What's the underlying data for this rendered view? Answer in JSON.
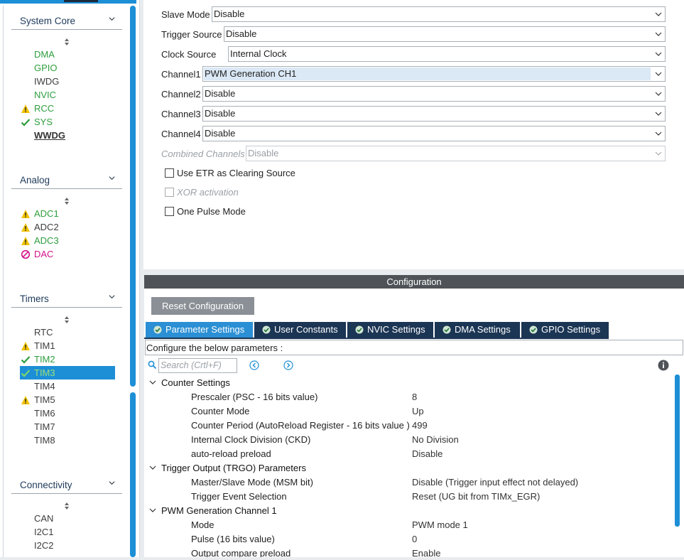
{
  "sidebar": {
    "categories": [
      {
        "label": "System Core",
        "items": [
          {
            "label": "DMA",
            "status": "ok",
            "color": "green"
          },
          {
            "label": "GPIO",
            "status": "ok",
            "color": "green"
          },
          {
            "label": "IWDG",
            "status": "none",
            "color": "gray"
          },
          {
            "label": "NVIC",
            "status": "ok",
            "color": "green"
          },
          {
            "label": "RCC",
            "status": "warning",
            "color": "green"
          },
          {
            "label": "SYS",
            "status": "checked",
            "color": "green"
          },
          {
            "label": "WWDG",
            "status": "none",
            "color": "gray"
          }
        ]
      },
      {
        "label": "Analog",
        "items": [
          {
            "label": "ADC1",
            "status": "warning",
            "color": "green"
          },
          {
            "label": "ADC2",
            "status": "warning",
            "color": "gray"
          },
          {
            "label": "ADC3",
            "status": "warning",
            "color": "green"
          },
          {
            "label": "DAC",
            "status": "disabled",
            "color": "pink"
          }
        ]
      },
      {
        "label": "Timers",
        "items": [
          {
            "label": "RTC",
            "status": "none",
            "color": "gray"
          },
          {
            "label": "TIM1",
            "status": "warning",
            "color": "gray"
          },
          {
            "label": "TIM2",
            "status": "checked",
            "color": "green"
          },
          {
            "label": "TIM3",
            "status": "checked",
            "color": "green",
            "selected": true
          },
          {
            "label": "TIM4",
            "status": "none",
            "color": "gray"
          },
          {
            "label": "TIM5",
            "status": "warning",
            "color": "gray"
          },
          {
            "label": "TIM6",
            "status": "none",
            "color": "gray"
          },
          {
            "label": "TIM7",
            "status": "none",
            "color": "gray"
          },
          {
            "label": "TIM8",
            "status": "none",
            "color": "gray"
          }
        ]
      },
      {
        "label": "Connectivity",
        "items": [
          {
            "label": "CAN",
            "status": "none",
            "color": "gray"
          },
          {
            "label": "I2C1",
            "status": "none",
            "color": "gray"
          },
          {
            "label": "I2C2",
            "status": "none",
            "color": "gray"
          }
        ]
      }
    ]
  },
  "mode": {
    "slave_mode": {
      "label": "Slave Mode",
      "value": "Disable"
    },
    "trigger_source": {
      "label": "Trigger Source",
      "value": "Disable"
    },
    "clock_source": {
      "label": "Clock Source",
      "value": "Internal Clock"
    },
    "channel1": {
      "label": "Channel1",
      "value": "PWM Generation CH1"
    },
    "channel2": {
      "label": "Channel2",
      "value": "Disable"
    },
    "channel3": {
      "label": "Channel3",
      "value": "Disable"
    },
    "channel4": {
      "label": "Channel4",
      "value": "Disable"
    },
    "combined_channels": {
      "label": "Combined Channels",
      "value": "Disable"
    },
    "use_etr": "Use ETR as Clearing Source",
    "xor_activation": "XOR activation",
    "one_pulse": "One Pulse Mode"
  },
  "config": {
    "title": "Configuration",
    "reset_label": "Reset Configuration",
    "tabs": [
      "Parameter Settings",
      "User Constants",
      "NVIC Settings",
      "DMA Settings",
      "GPIO Settings"
    ],
    "description": "Configure the below parameters :",
    "search_placeholder": "Search (Crtl+F)",
    "groups": [
      {
        "name": "Counter Settings",
        "params": [
          {
            "name": "Prescaler (PSC - 16 bits value)",
            "value": "8"
          },
          {
            "name": "Counter Mode",
            "value": "Up"
          },
          {
            "name": "Counter Period (AutoReload Register - 16 bits value )",
            "value": "499"
          },
          {
            "name": "Internal Clock Division (CKD)",
            "value": "No Division"
          },
          {
            "name": "auto-reload preload",
            "value": "Disable"
          }
        ]
      },
      {
        "name": "Trigger Output (TRGO) Parameters",
        "params": [
          {
            "name": "Master/Slave Mode (MSM bit)",
            "value": "Disable (Trigger input effect not delayed)"
          },
          {
            "name": "Trigger Event Selection",
            "value": "Reset (UG bit from TIMx_EGR)"
          }
        ]
      },
      {
        "name": "PWM Generation Channel 1",
        "params": [
          {
            "name": "Mode",
            "value": "PWM mode 1"
          },
          {
            "name": "Pulse (16 bits value)",
            "value": "0"
          },
          {
            "name": "Output compare preload",
            "value": "Enable"
          }
        ]
      }
    ]
  },
  "colors": {
    "accent": "#1d8fd6",
    "tab_dark": "#1b3554",
    "ok_green": "#2e9e3e",
    "warning": "#f2c200",
    "disabled_pink": "#d1138a"
  }
}
